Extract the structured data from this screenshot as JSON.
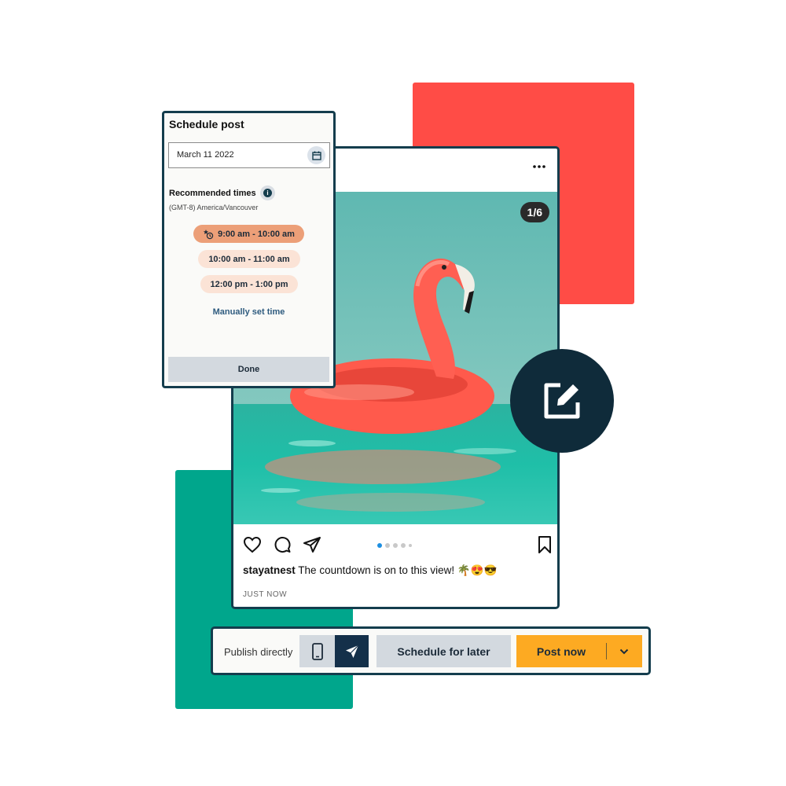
{
  "schedule_panel": {
    "title": "Schedule post",
    "date_value": "March 11 2022",
    "recommended_label": "Recommended times",
    "timezone": "(GMT-8) America/Vancouver",
    "time_slots": [
      {
        "label": "9:00 am - 10:00 am",
        "selected": true
      },
      {
        "label": "10:00 am - 11:00 am",
        "selected": false
      },
      {
        "label": "12:00 pm - 1:00 pm",
        "selected": false
      }
    ],
    "manual_link": "Manually set time",
    "done_label": "Done"
  },
  "post": {
    "image_counter": "1/6",
    "username": "stayatnest",
    "caption": " The countdown is on to this view! 🌴😍😎",
    "timestamp": "JUST NOW",
    "carousel": {
      "total_dots": 5,
      "active_index": 0
    }
  },
  "publish_bar": {
    "label": "Publish directly",
    "schedule_later_label": "Schedule for later",
    "post_now_label": "Post now"
  },
  "colors": {
    "navy": "#143d4d",
    "red_block": "#ff4c46",
    "green_block": "#00a68c",
    "post_now": "#fdaa22",
    "slot_selected": "#ec9f78",
    "slot": "#fbe3d6"
  },
  "icons": [
    "ellipsis-icon",
    "calendar-icon",
    "info-icon",
    "star-clock-icon",
    "heart-icon",
    "comment-icon",
    "send-icon",
    "bookmark-icon",
    "edit-icon",
    "phone-icon",
    "paper-plane-icon",
    "chevron-down-icon"
  ]
}
